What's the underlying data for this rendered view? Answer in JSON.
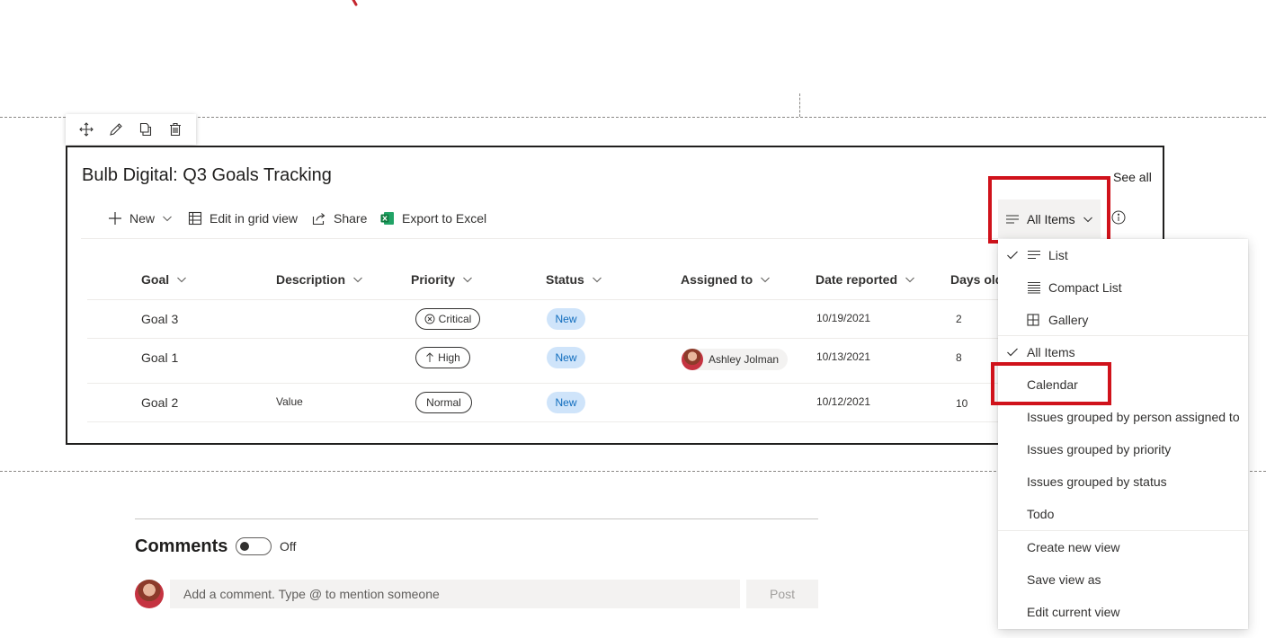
{
  "webpart": {
    "title": "Bulb Digital: Q3 Goals Tracking",
    "see_all": "See all",
    "toolbar_icons": [
      "move-icon",
      "edit-icon",
      "duplicate-icon",
      "delete-icon"
    ]
  },
  "commands": {
    "new": "New",
    "edit_grid": "Edit in grid view",
    "share": "Share",
    "export": "Export to Excel"
  },
  "view_button": {
    "label": "All Items"
  },
  "table": {
    "columns": [
      "Goal",
      "Description",
      "Priority",
      "Status",
      "Assigned to",
      "Date reported",
      "Days old"
    ],
    "rows": [
      {
        "goal": "Goal 3",
        "description": "",
        "priority": "Critical",
        "priority_icon": "cancel-circle-icon",
        "status": "New",
        "assigned_to": "",
        "date_reported": "10/19/2021",
        "days_old": "2"
      },
      {
        "goal": "Goal 1",
        "description": "",
        "priority": "High",
        "priority_icon": "arrow-up-icon",
        "status": "New",
        "assigned_to": "Ashley Jolman",
        "date_reported": "10/13/2021",
        "days_old": "8"
      },
      {
        "goal": "Goal 2",
        "description": "Value",
        "priority": "Normal",
        "priority_icon": "",
        "status": "New",
        "assigned_to": "",
        "date_reported": "10/12/2021",
        "days_old": "10"
      }
    ]
  },
  "menu": {
    "layouts": [
      {
        "label": "List",
        "checked": true,
        "icon": "list-icon"
      },
      {
        "label": "Compact List",
        "checked": false,
        "icon": "compact-list-icon"
      },
      {
        "label": "Gallery",
        "checked": false,
        "icon": "gallery-icon"
      }
    ],
    "views": [
      {
        "label": "All Items",
        "checked": true
      },
      {
        "label": "Calendar",
        "checked": false,
        "highlighted": true
      },
      {
        "label": "Issues grouped by person assigned to",
        "checked": false
      },
      {
        "label": "Issues grouped by priority",
        "checked": false
      },
      {
        "label": "Issues grouped by status",
        "checked": false
      },
      {
        "label": "Todo",
        "checked": false
      }
    ],
    "actions": [
      "Create new view",
      "Save view as",
      "Edit current view"
    ]
  },
  "comments": {
    "title": "Comments",
    "toggle_state": "Off",
    "placeholder": "Add a comment. Type @ to mention someone",
    "post": "Post"
  },
  "colors": {
    "highlight_box": "#d0121b",
    "status_bg": "#cfe4fa",
    "status_text": "#0f6cbd",
    "excel_green": "#107c41"
  }
}
